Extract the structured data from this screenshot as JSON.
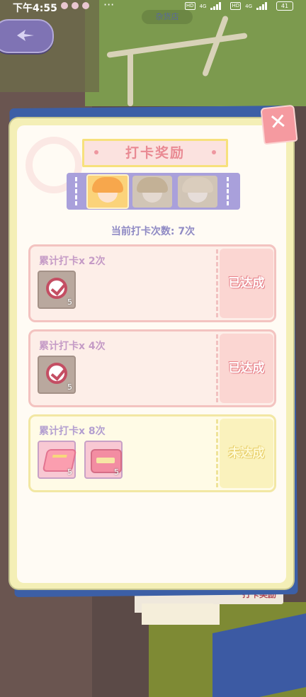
{
  "status_bar": {
    "time": "下午4:55",
    "more": "···",
    "network_1": "4G",
    "network_2": "4G",
    "hd_1": "HD",
    "hd_2": "HD",
    "battery": "41"
  },
  "background": {
    "shop_label": "杂货店",
    "tab_label": "打卡奖励"
  },
  "modal": {
    "title": "打卡奖励",
    "current_count": "当前打卡次数: 7次",
    "avatars": [
      {
        "name": "avatar-1",
        "state": "selected"
      },
      {
        "name": "avatar-2",
        "state": "dimmed"
      },
      {
        "name": "avatar-3",
        "state": "dimmed"
      }
    ],
    "rewards": [
      {
        "title": "累计打卡x 2次",
        "status": "已达成",
        "achieved": true,
        "items": [
          {
            "icon": "check-badge-icon",
            "qty": "5"
          }
        ]
      },
      {
        "title": "累计打卡x 4次",
        "status": "已达成",
        "achieved": true,
        "items": [
          {
            "icon": "check-badge-icon",
            "qty": "5"
          }
        ]
      },
      {
        "title": "累计打卡x 8次",
        "status": "未达成",
        "achieved": false,
        "items": [
          {
            "icon": "cushion-icon",
            "qty": "5"
          },
          {
            "icon": "pink-box-icon",
            "qty": "5"
          }
        ]
      }
    ]
  },
  "colors": {
    "accent_pink": "#e98a93",
    "lavender": "#a9a0db",
    "done_card": "#fdeee8",
    "todo_card": "#fffbe6"
  }
}
